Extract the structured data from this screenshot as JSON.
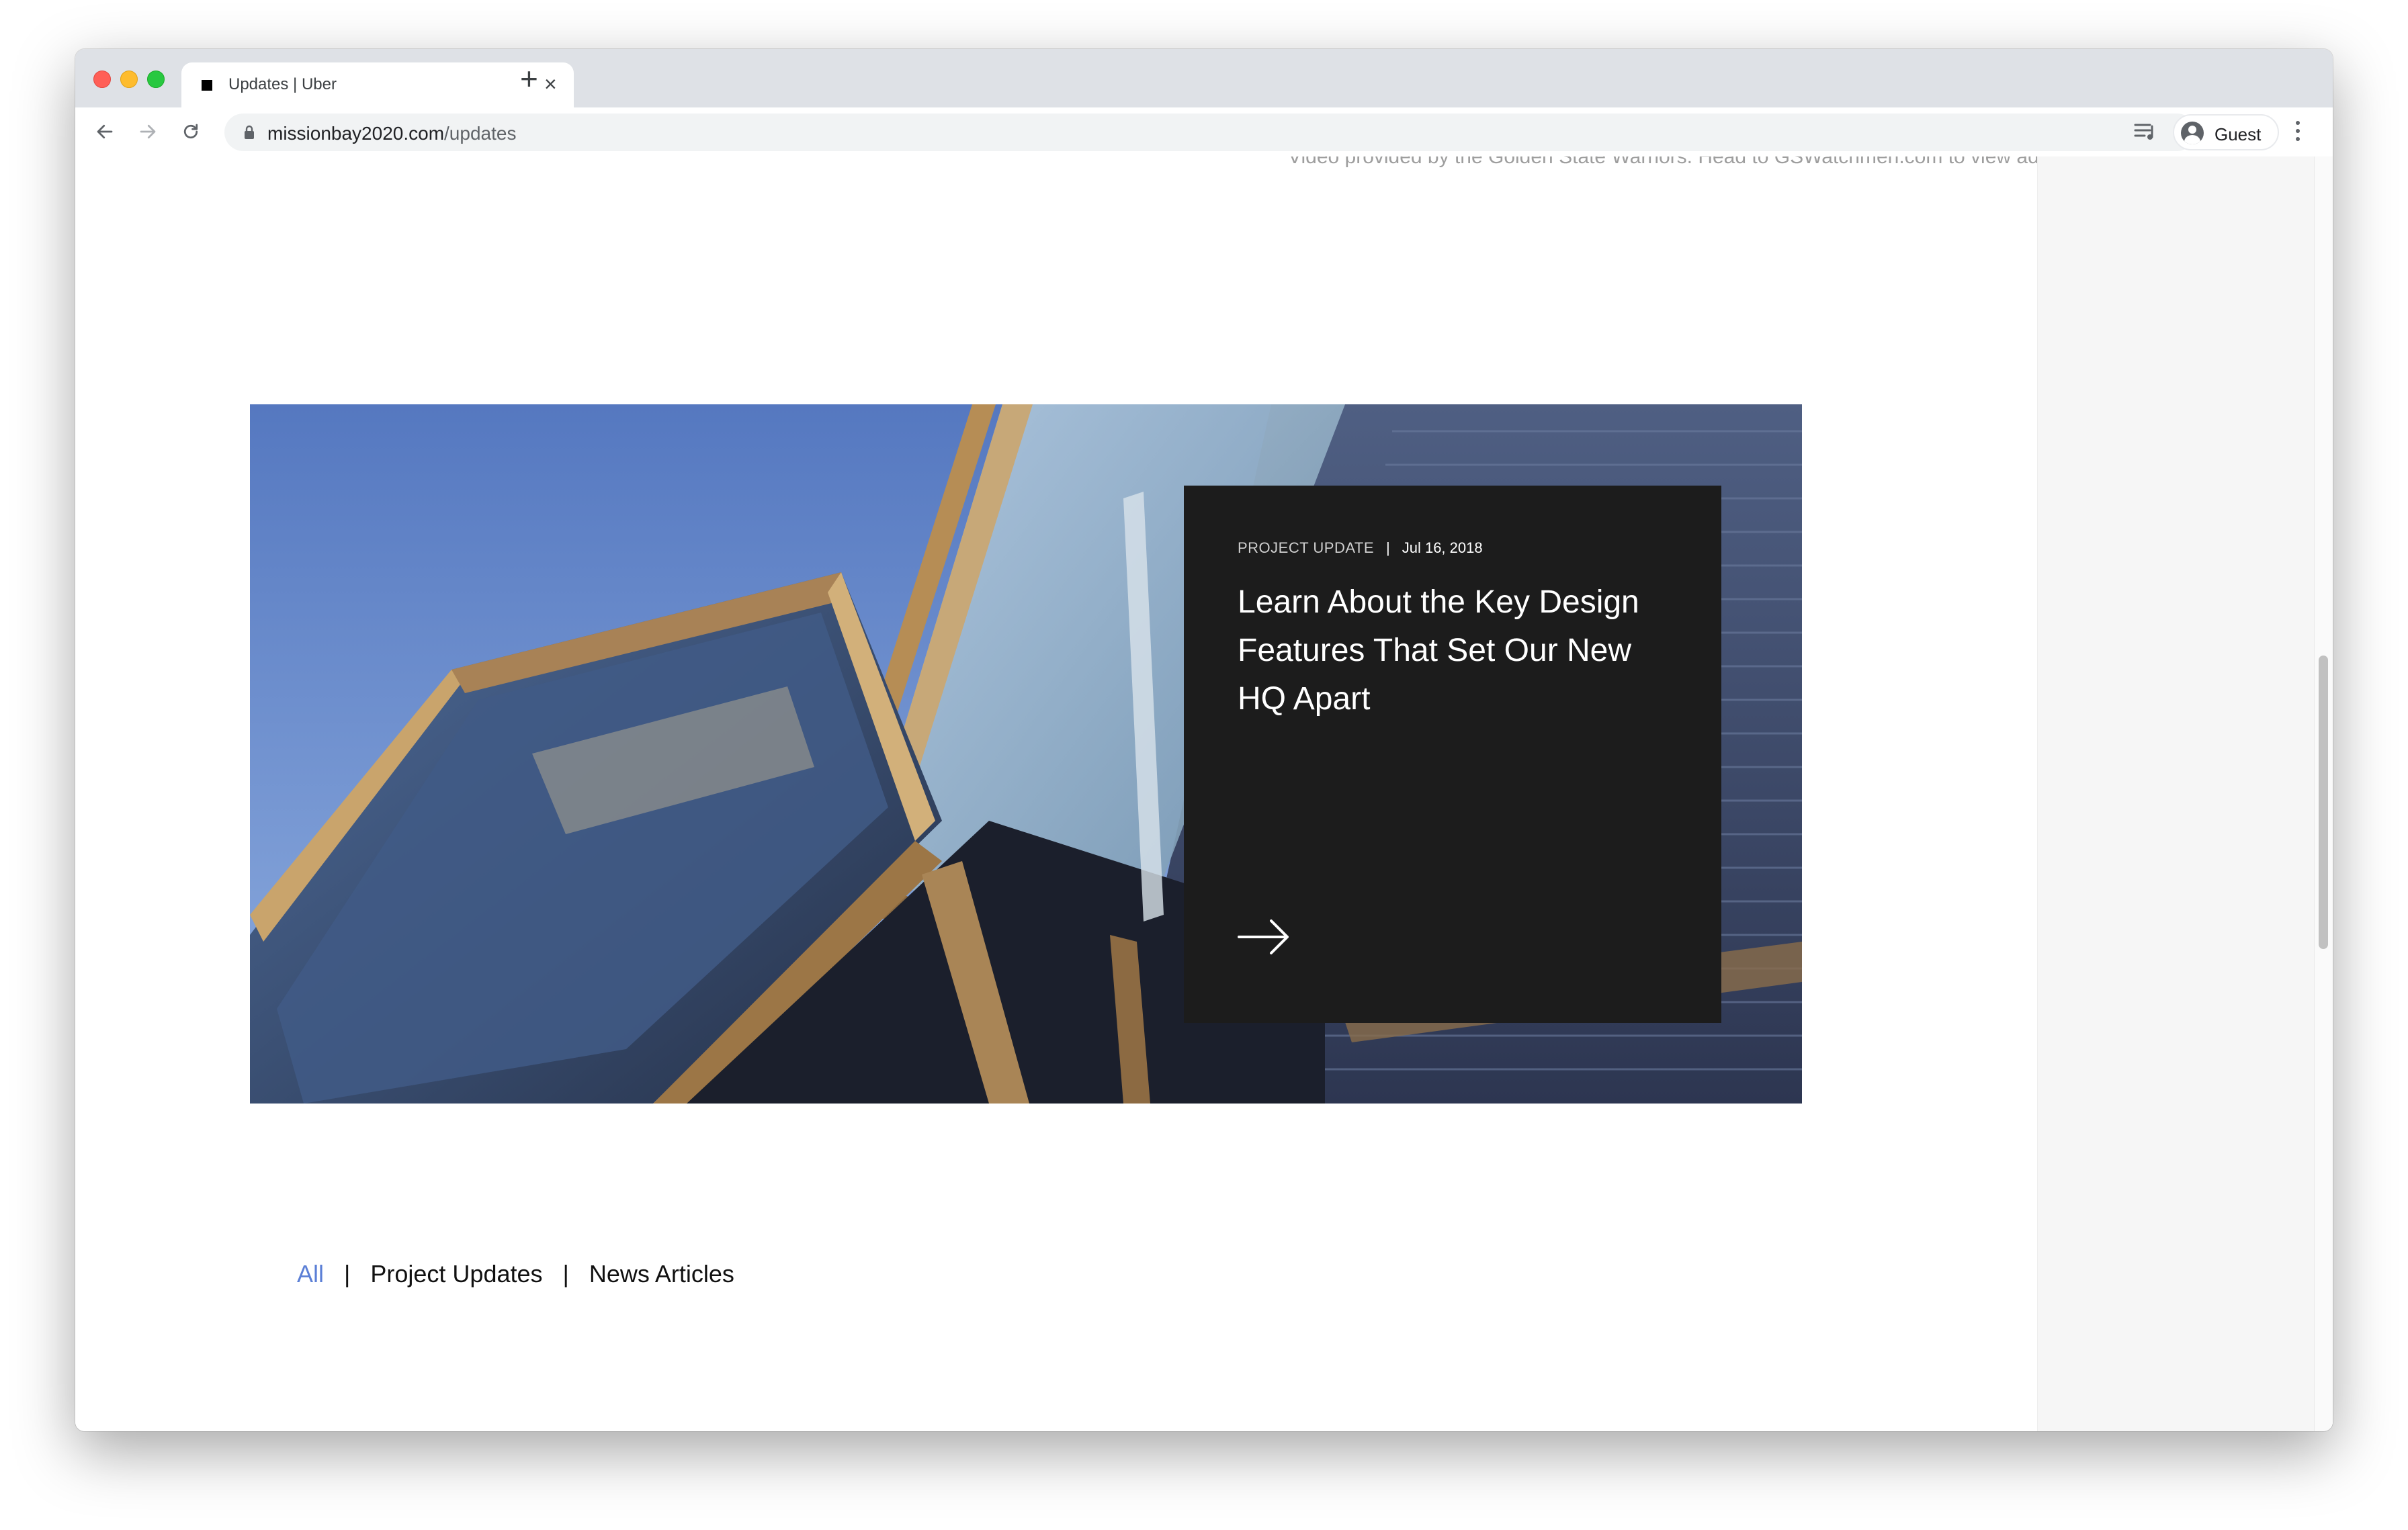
{
  "browser": {
    "tab": {
      "title": "Updates | Uber",
      "close_label": "×"
    },
    "new_tab_label": "+",
    "address": {
      "domain": "missionbay2020.com",
      "path": "/updates"
    },
    "profile": {
      "name": "Guest"
    }
  },
  "page": {
    "cut_caption": "Video provided by the Golden State Warriors. Head to GSWatchmen.com to view additional camera feeds.",
    "featured": {
      "category": "PROJECT UPDATE",
      "separator": "|",
      "date": "Jul 16, 2018",
      "headline": "Learn About the Key Design Features That Set Our New HQ Apart"
    },
    "filters": {
      "items": [
        {
          "label": "All"
        },
        {
          "label": "Project Updates"
        },
        {
          "label": "News Articles"
        }
      ],
      "separator": "|",
      "active_color": "#5b7fd6"
    }
  },
  "icons": {
    "back": "arrow-left-icon",
    "forward": "arrow-right-icon",
    "reload": "reload-icon",
    "lock": "lock-icon",
    "media": "media-queue-icon",
    "menu": "vertical-dots-icon",
    "card_arrow": "arrow-right-icon"
  }
}
